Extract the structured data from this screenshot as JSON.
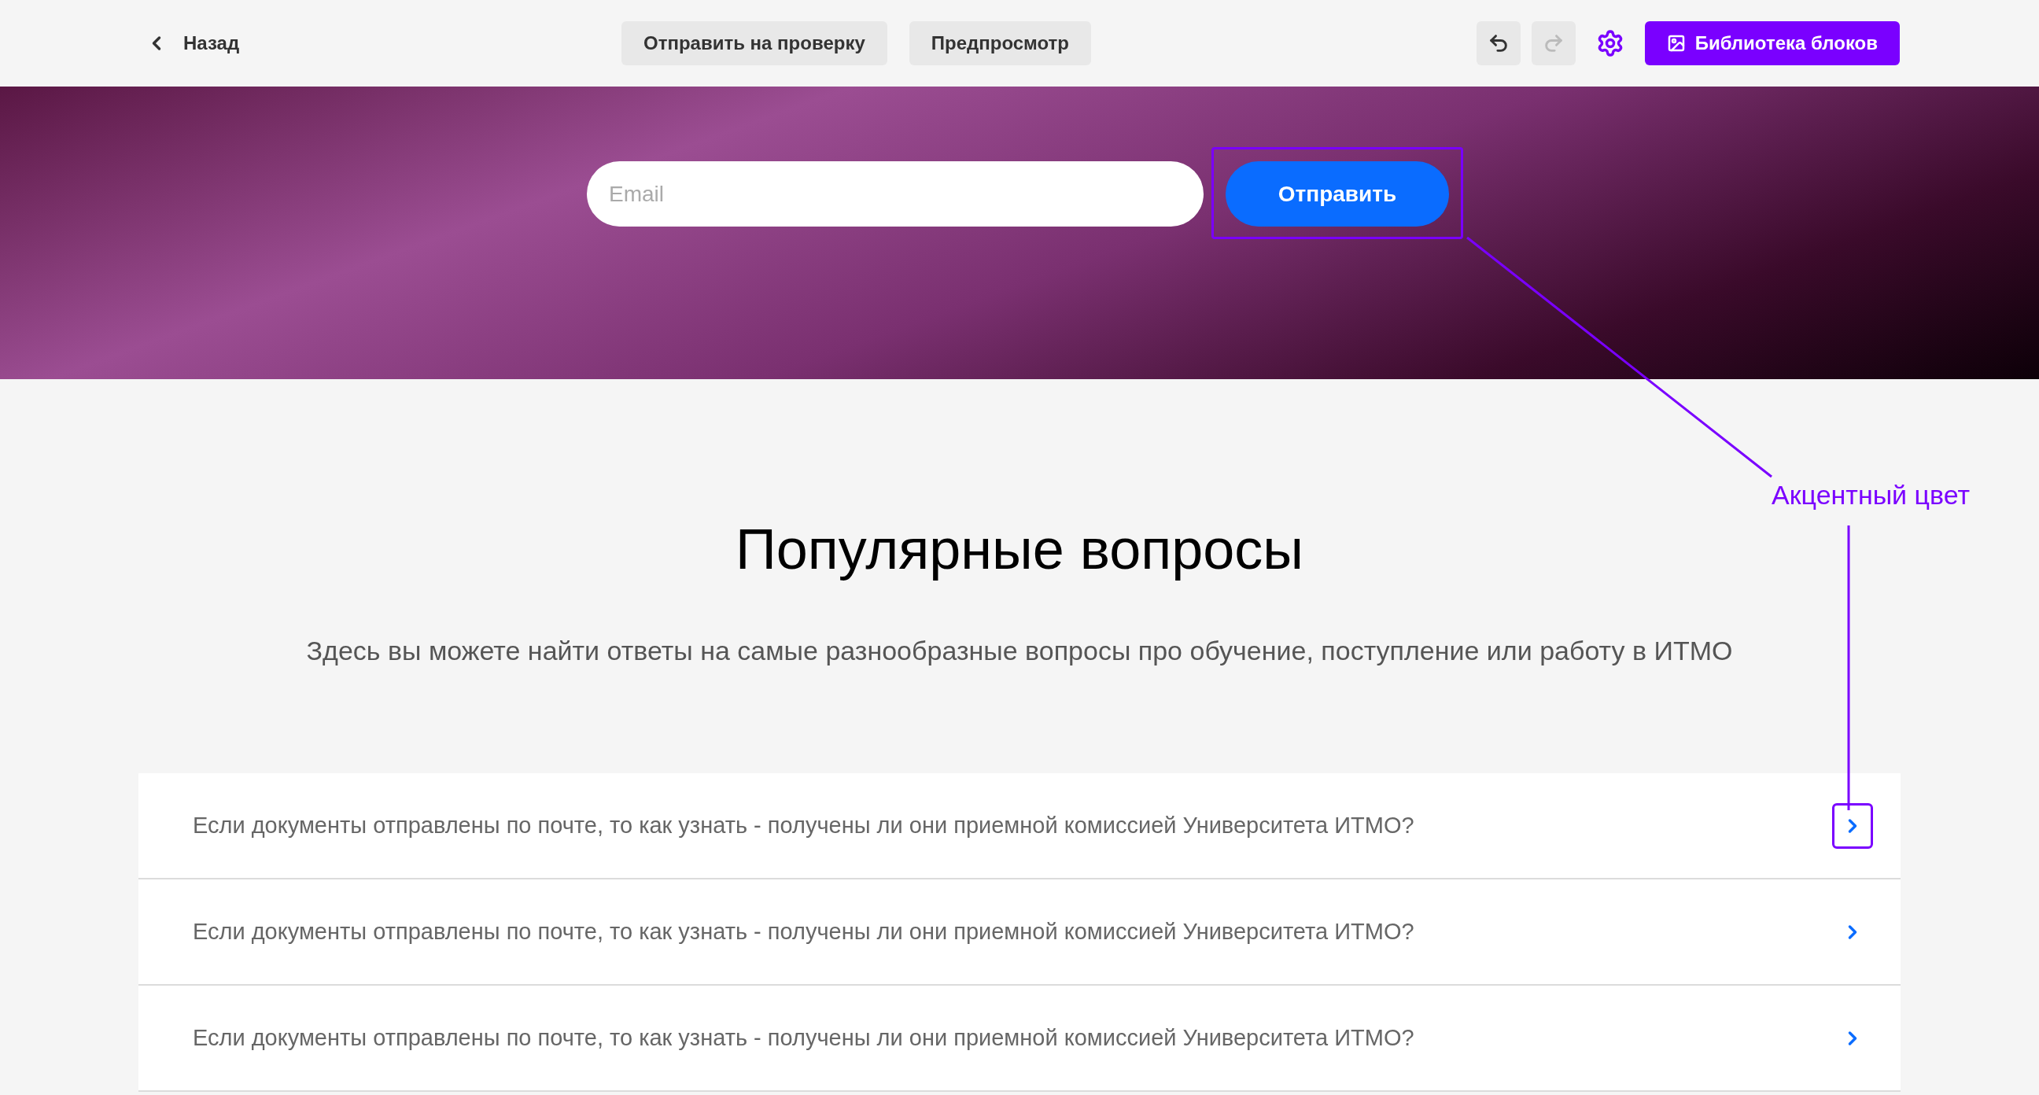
{
  "toolbar": {
    "back": "Назад",
    "review_button": "Отправить на проверку",
    "preview_button": "Предпросмотр",
    "library_button": "Библиотека блоков",
    "undo_disabled": false,
    "redo_disabled": true
  },
  "banner": {
    "email_placeholder": "Email",
    "submit_button": "Отправить",
    "submit_annotated": true
  },
  "annotation": {
    "label": "Акцентный цвет"
  },
  "faq": {
    "title": "Популярные вопросы",
    "subtitle": "Здесь вы можете найти ответы на самые разнообразные вопросы про обучение, поступление или работу в ИТМО",
    "items": [
      {
        "question": "Если документы отправлены по почте, то как узнать - получены ли они приемной комиссией Университета ИТМО?",
        "annotated": true
      },
      {
        "question": "Если документы отправлены по почте, то как узнать - получены ли они приемной комиссией Университета ИТМО?",
        "annotated": false
      },
      {
        "question": "Если документы отправлены по почте, то как узнать - получены ли они приемной комиссией Университета ИТМО?",
        "annotated": false
      }
    ]
  }
}
